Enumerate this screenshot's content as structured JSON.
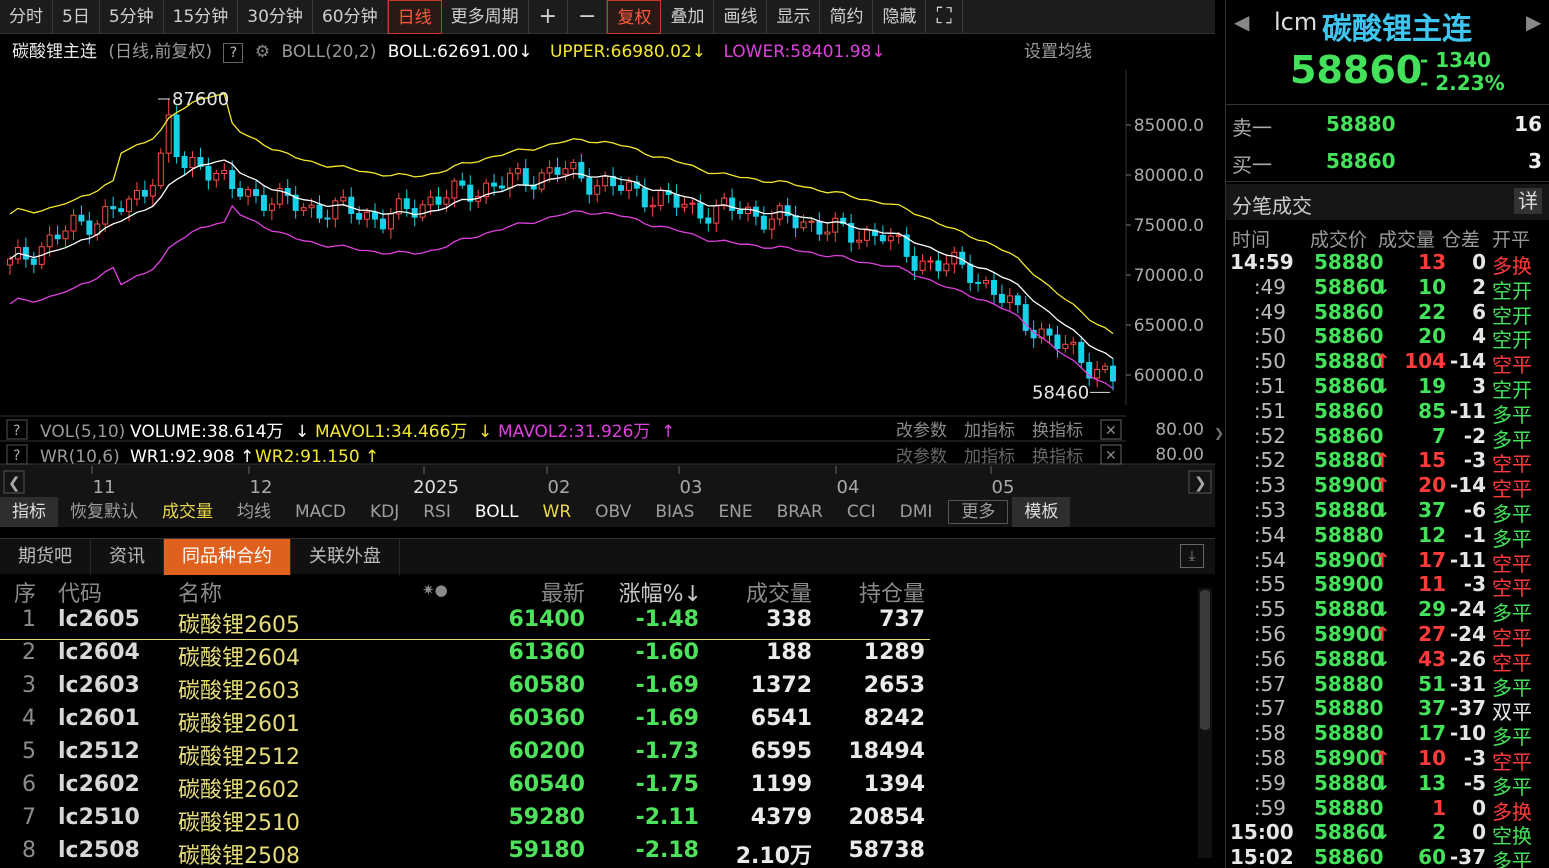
{
  "toolbar": {
    "items": [
      "分时",
      "5日",
      "5分钟",
      "15分钟",
      "30分钟",
      "60分钟",
      "日线",
      "更多周期",
      "+",
      "−",
      "复权",
      "叠加",
      "画线",
      "显示",
      "简约",
      "隐藏",
      "⛶"
    ]
  },
  "info": {
    "name": "碳酸锂主连",
    "period": "(日线,前复权)",
    "help": "?",
    "boll_label": "BOLL(20,2)",
    "boll": "BOLL:62691.00",
    "upper": "UPPER:66980.02",
    "lower": "LOWER:58401.98",
    "set_ma": "设置均线",
    "arrow_down": "↓"
  },
  "chart_data": {
    "type": "candlestick",
    "title": "碳酸锂主连",
    "y_ticks": [
      "85000.0",
      "80000.0",
      "75000.0",
      "70000.0",
      "65000.0",
      "60000.0"
    ],
    "ylim": [
      58000,
      88500
    ],
    "x_ticks": [
      "11",
      "12",
      "2025",
      "02",
      "03",
      "04",
      "05"
    ],
    "high_label": "87600",
    "low_label": "58460"
  },
  "volpanel": {
    "vol": "VOL(5,10)",
    "volume": "VOLUME:38.614万",
    "mavol1": "MAVOL1:34.466万",
    "mavol2": "MAVOL2:31.926万",
    "wr": "WR(10,6)",
    "wr1": "WR1:92.908",
    "wr2": "WR2:91.150",
    "btn1": "改参数",
    "btn2": "加指标",
    "btn3": "换指标",
    "v1": "80.00",
    "v2": "80.00",
    "up": "↑",
    "down": "↓"
  },
  "indicators": [
    "指标",
    "恢复默认",
    "成交量",
    "均线",
    "MACD",
    "KDJ",
    "RSI",
    "BOLL",
    "WR",
    "OBV",
    "BIAS",
    "ENE",
    "BRAR",
    "CCI",
    "DMI",
    "更多",
    "模板"
  ],
  "bottom_tabs": [
    "期货吧",
    "资讯",
    "同品种合约",
    "关联外盘"
  ],
  "table": {
    "headers": [
      "序",
      "代码",
      "名称",
      "✷●",
      "最新",
      "涨幅%↓",
      "成交量",
      "持仓量"
    ],
    "rows": [
      [
        "1",
        "lc2605",
        "碳酸锂2605",
        "61400",
        "-1.48",
        "338",
        "737"
      ],
      [
        "2",
        "lc2604",
        "碳酸锂2604",
        "61360",
        "-1.60",
        "188",
        "1289"
      ],
      [
        "3",
        "lc2603",
        "碳酸锂2603",
        "60580",
        "-1.69",
        "1372",
        "2653"
      ],
      [
        "4",
        "lc2601",
        "碳酸锂2601",
        "60360",
        "-1.69",
        "6541",
        "8242"
      ],
      [
        "5",
        "lc2512",
        "碳酸锂2512",
        "60200",
        "-1.73",
        "6595",
        "18494"
      ],
      [
        "6",
        "lc2602",
        "碳酸锂2602",
        "60540",
        "-1.75",
        "1199",
        "1394"
      ],
      [
        "7",
        "lc2510",
        "碳酸锂2510",
        "59280",
        "-2.11",
        "4379",
        "20854"
      ],
      [
        "8",
        "lc2508",
        "碳酸锂2508",
        "59180",
        "-2.18",
        "2.10万",
        "58738"
      ]
    ]
  },
  "quote": {
    "code": "lcm",
    "name": "碳酸锂主连",
    "price": "58860",
    "change": "- 1340",
    "pct": "- 2.23%",
    "sell_label": "卖一",
    "sell_price": "58880",
    "sell_vol": "16",
    "buy_label": "买一",
    "buy_price": "58860",
    "buy_vol": "3",
    "ticks_title": "分笔成交",
    "detail": "详",
    "prev": "◀",
    "next": "▶"
  },
  "ticks_header": [
    "时间",
    "成交价",
    "成交量",
    "仓差",
    "开平"
  ],
  "ticks": [
    [
      "14:59",
      "58880",
      "",
      "13",
      "0",
      "多换",
      "r",
      "r"
    ],
    [
      ":49",
      "58860",
      "↓",
      "10",
      "2",
      "空开",
      "g",
      "g"
    ],
    [
      ":49",
      "58860",
      "",
      "22",
      "6",
      "空开",
      "g",
      "g"
    ],
    [
      ":50",
      "58860",
      "",
      "20",
      "4",
      "空开",
      "g",
      "g"
    ],
    [
      ":50",
      "58880",
      "↑",
      "104",
      "-14",
      "空平",
      "r",
      "r"
    ],
    [
      ":51",
      "58860",
      "↓",
      "19",
      "3",
      "空开",
      "g",
      "g"
    ],
    [
      ":51",
      "58860",
      "",
      "85",
      "-11",
      "多平",
      "g",
      "g"
    ],
    [
      ":52",
      "58860",
      "",
      "7",
      "-2",
      "多平",
      "g",
      "g"
    ],
    [
      ":52",
      "58880",
      "↑",
      "15",
      "-3",
      "空平",
      "r",
      "r"
    ],
    [
      ":53",
      "58900",
      "↑",
      "20",
      "-14",
      "空平",
      "r",
      "r"
    ],
    [
      ":53",
      "58880",
      "↓",
      "37",
      "-6",
      "多平",
      "g",
      "g"
    ],
    [
      ":54",
      "58880",
      "",
      "12",
      "-1",
      "多平",
      "g",
      "g"
    ],
    [
      ":54",
      "58900",
      "↑",
      "17",
      "-11",
      "空平",
      "r",
      "r"
    ],
    [
      ":55",
      "58900",
      "",
      "11",
      "-3",
      "空平",
      "r",
      "r"
    ],
    [
      ":55",
      "58880",
      "↓",
      "29",
      "-24",
      "多平",
      "g",
      "g"
    ],
    [
      ":56",
      "58900",
      "↑",
      "27",
      "-24",
      "空平",
      "r",
      "r"
    ],
    [
      ":56",
      "58880",
      "↓",
      "43",
      "-26",
      "空平",
      "r",
      "r"
    ],
    [
      ":57",
      "58880",
      "",
      "51",
      "-31",
      "多平",
      "g",
      "g"
    ],
    [
      ":57",
      "58880",
      "",
      "37",
      "-37",
      "双平",
      "g",
      "w"
    ],
    [
      ":58",
      "58880",
      "",
      "17",
      "-10",
      "多平",
      "g",
      "g"
    ],
    [
      ":58",
      "58900",
      "↑",
      "10",
      "-3",
      "空平",
      "r",
      "r"
    ],
    [
      ":59",
      "58880",
      "↓",
      "13",
      "-5",
      "多平",
      "g",
      "g"
    ],
    [
      ":59",
      "58880",
      "",
      "1",
      "0",
      "多换",
      "r",
      "r"
    ],
    [
      "15:00",
      "58860",
      "↓",
      "2",
      "0",
      "空换",
      "g",
      "g"
    ],
    [
      "15:02",
      "58860",
      "",
      "60",
      "-37",
      "多平",
      "g",
      "g"
    ]
  ]
}
